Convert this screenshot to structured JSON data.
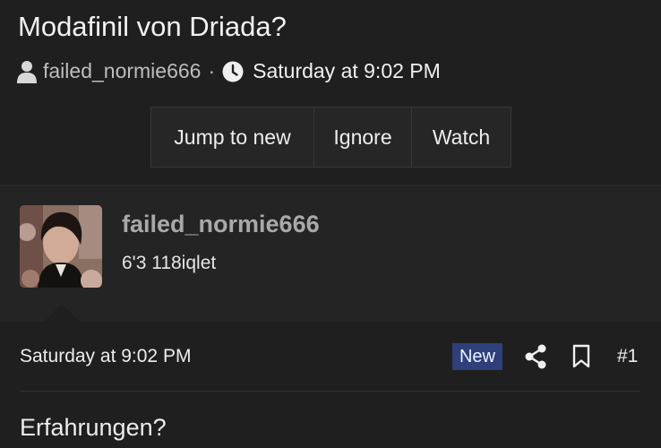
{
  "thread": {
    "title": "Modafinil von Driada?",
    "author": "failed_normie666",
    "separator": "·",
    "date": "Saturday at 9:02 PM"
  },
  "actions": {
    "jump_label": "Jump to new",
    "ignore_label": "Ignore",
    "watch_label": "Watch"
  },
  "user": {
    "name": "failed_normie666",
    "title": "6'3 118iqlet"
  },
  "post": {
    "date": "Saturday at 9:02 PM",
    "badge": "New",
    "number": "#1",
    "body": "Erfahrungen?"
  },
  "icons": {
    "author": "user-icon",
    "date": "clock-icon",
    "share": "share-icon",
    "bookmark": "bookmark-icon"
  },
  "colors": {
    "background": "#1f1f1f",
    "user_block": "#242424",
    "badge": "#2e3f7a"
  }
}
